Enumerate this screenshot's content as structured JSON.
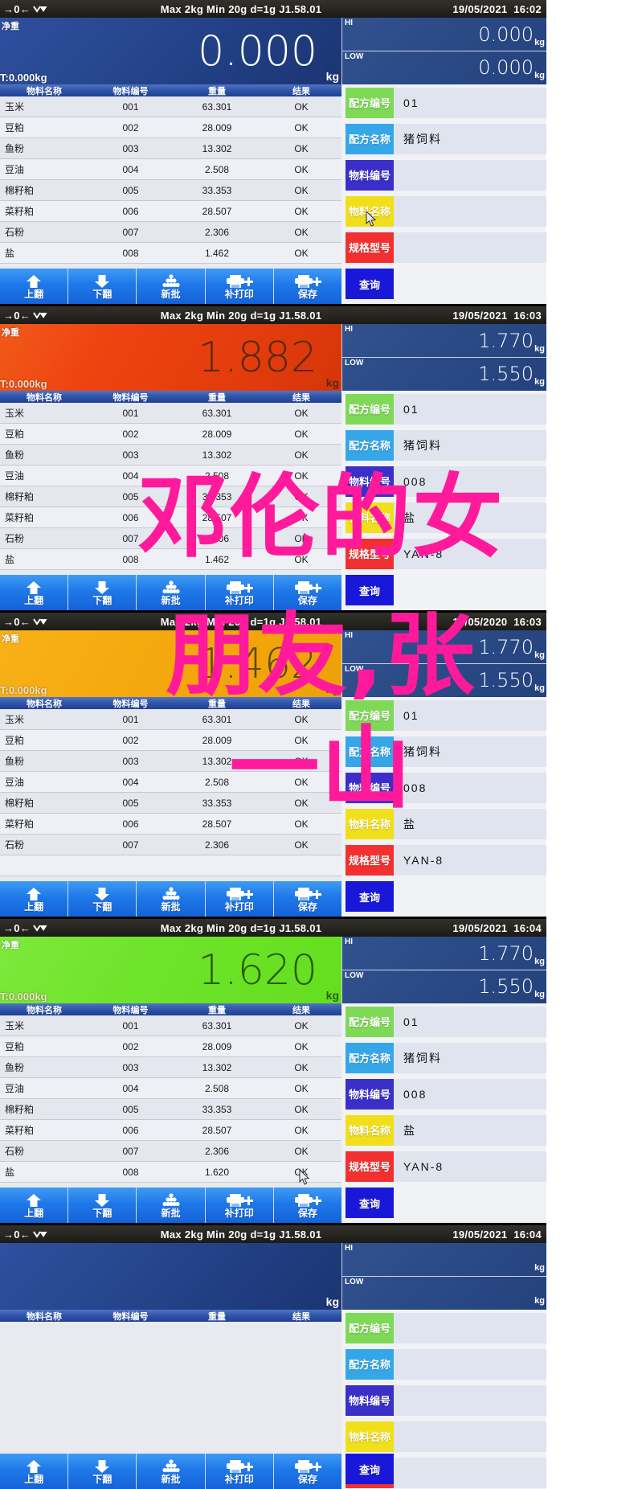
{
  "watermark": {
    "color": "#ff1a9b",
    "line1": "邓伦的女",
    "line2": "朋友,张",
    "line3": "一山"
  },
  "icons": {
    "zero": "→0←",
    "stable": "stable-icon",
    "up_arrow": "up-arrow-icon",
    "down_arrow": "down-arrow-icon",
    "batch": "stacked-bags-icon",
    "printer": "printer-plus-icon",
    "cursor": "mouse-cursor-icon"
  },
  "table_headers": {
    "name": "物料名称",
    "code": "物料编号",
    "weight": "重量",
    "result": "结果"
  },
  "buttons": [
    {
      "label": "上翻",
      "icon": "up-arrow-icon"
    },
    {
      "label": "下翻",
      "icon": "down-arrow-icon"
    },
    {
      "label": "新批",
      "icon": "stacked-bags-icon"
    },
    {
      "label": "补打印",
      "icon": "printer-plus-icon"
    },
    {
      "label": "保存",
      "icon": "printer-plus-icon"
    }
  ],
  "query_button": "查询",
  "field_keys": {
    "recipe_no": "配方编号",
    "recipe_name": "配方名称",
    "material_no": "物料编号",
    "material_name": "物料名称",
    "spec_model": "规格型号"
  },
  "field_colors": {
    "recipe_no": "#7ed957",
    "recipe_name": "#35a7e8",
    "material_no": "#3b2fc9",
    "material_name": "#f2df1b",
    "spec_model": "#f23030"
  },
  "hi_low_labels": {
    "hi": "HI",
    "low": "LOW"
  },
  "unit": "kg",
  "panels": [
    {
      "status": {
        "spec": "Max 2kg  Min 20g  d=1g    J1.58.01",
        "date": "19/05/2021",
        "time": "16:02"
      },
      "weight": {
        "net_label": "净重",
        "value": "0.000",
        "unit": "kg",
        "tare": "T:0.000kg",
        "color": "blue"
      },
      "hi": "0.000",
      "low": "0.000",
      "rows": [
        {
          "name": "玉米",
          "code": "001",
          "weight": "63.301",
          "result": "OK"
        },
        {
          "name": "豆粕",
          "code": "002",
          "weight": "28.009",
          "result": "OK"
        },
        {
          "name": "鱼粉",
          "code": "003",
          "weight": "13.302",
          "result": "OK"
        },
        {
          "name": "豆油",
          "code": "004",
          "weight": "2.508",
          "result": "OK"
        },
        {
          "name": "棉籽粕",
          "code": "005",
          "weight": "33.353",
          "result": "OK"
        },
        {
          "name": "菜籽粕",
          "code": "006",
          "weight": "28.507",
          "result": "OK"
        },
        {
          "name": "石粉",
          "code": "007",
          "weight": "2.306",
          "result": "OK"
        },
        {
          "name": "盐",
          "code": "008",
          "weight": "1.462",
          "result": "OK"
        }
      ],
      "fields": {
        "recipe_no": "01",
        "recipe_name": "猪饲料",
        "material_no": "",
        "material_name": "",
        "spec_model": ""
      }
    },
    {
      "status": {
        "spec": "Max 2kg  Min 20g  d=1g    J1.58.01",
        "date": "19/05/2021",
        "time": "16:03"
      },
      "weight": {
        "net_label": "净重",
        "value": "1.882",
        "unit": "kg",
        "tare": "T:0.000kg",
        "color": "red"
      },
      "hi": "1.770",
      "low": "1.550",
      "rows": [
        {
          "name": "玉米",
          "code": "001",
          "weight": "63.301",
          "result": "OK"
        },
        {
          "name": "豆粕",
          "code": "002",
          "weight": "28.009",
          "result": "OK"
        },
        {
          "name": "鱼粉",
          "code": "003",
          "weight": "13.302",
          "result": "OK"
        },
        {
          "name": "豆油",
          "code": "004",
          "weight": "2.508",
          "result": "OK"
        },
        {
          "name": "棉籽粕",
          "code": "005",
          "weight": "33.353",
          "result": "OK"
        },
        {
          "name": "菜籽粕",
          "code": "006",
          "weight": "28.507",
          "result": "OK"
        },
        {
          "name": "石粉",
          "code": "007",
          "weight": "2.306",
          "result": "OK"
        },
        {
          "name": "盐",
          "code": "008",
          "weight": "1.462",
          "result": "OK"
        }
      ],
      "fields": {
        "recipe_no": "01",
        "recipe_name": "猪饲料",
        "material_no": "008",
        "material_name": "盐",
        "spec_model": "YAN-8"
      }
    },
    {
      "status": {
        "spec": "Max 2kg  Min 20g  d=1g    J1.58.01",
        "date": "19/05/2020",
        "time": "16:03"
      },
      "weight": {
        "net_label": "净重",
        "value": "1.462",
        "unit": "kg",
        "tare": "T:0.000kg",
        "color": "orange"
      },
      "hi": "1.770",
      "low": "1.550",
      "rows": [
        {
          "name": "玉米",
          "code": "001",
          "weight": "63.301",
          "result": "OK"
        },
        {
          "name": "豆粕",
          "code": "002",
          "weight": "28.009",
          "result": "OK"
        },
        {
          "name": "鱼粉",
          "code": "003",
          "weight": "13.302",
          "result": "OK"
        },
        {
          "name": "豆油",
          "code": "004",
          "weight": "2.508",
          "result": "OK"
        },
        {
          "name": "棉籽粕",
          "code": "005",
          "weight": "33.353",
          "result": "OK"
        },
        {
          "name": "菜籽粕",
          "code": "006",
          "weight": "28.507",
          "result": "OK"
        },
        {
          "name": "石粉",
          "code": "007",
          "weight": "2.306",
          "result": "OK"
        },
        {
          "name": "",
          "code": "",
          "weight": "",
          "result": ""
        }
      ],
      "fields": {
        "recipe_no": "01",
        "recipe_name": "猪饲料",
        "material_no": "008",
        "material_name": "盐",
        "spec_model": "YAN-8"
      }
    },
    {
      "status": {
        "spec": "Max 2kg  Min 20g  d=1g    J1.58.01",
        "date": "19/05/2021",
        "time": "16:04"
      },
      "weight": {
        "net_label": "净重",
        "value": "1.620",
        "unit": "kg",
        "tare": "T:0.000kg",
        "color": "green"
      },
      "hi": "1.770",
      "low": "1.550",
      "rows": [
        {
          "name": "玉米",
          "code": "001",
          "weight": "63.301",
          "result": "OK"
        },
        {
          "name": "豆粕",
          "code": "002",
          "weight": "28.009",
          "result": "OK"
        },
        {
          "name": "鱼粉",
          "code": "003",
          "weight": "13.302",
          "result": "OK"
        },
        {
          "name": "豆油",
          "code": "004",
          "weight": "2.508",
          "result": "OK"
        },
        {
          "name": "棉籽粕",
          "code": "005",
          "weight": "33.353",
          "result": "OK"
        },
        {
          "name": "菜籽粕",
          "code": "006",
          "weight": "28.507",
          "result": "OK"
        },
        {
          "name": "石粉",
          "code": "007",
          "weight": "2.306",
          "result": "OK"
        },
        {
          "name": "盐",
          "code": "008",
          "weight": "1.620",
          "result": "OK"
        }
      ],
      "fields": {
        "recipe_no": "01",
        "recipe_name": "猪饲料",
        "material_no": "008",
        "material_name": "盐",
        "spec_model": "YAN-8"
      }
    },
    {
      "status": {
        "spec": "Max 2kg  Min 20g  d=1g    J1.58.01",
        "date": "19/05/2021",
        "time": "16:04"
      },
      "weight": {
        "net_label": "",
        "value": "",
        "unit": "kg",
        "tare": "",
        "color": "blue"
      },
      "hi": "",
      "low": "",
      "rows": [],
      "fields": {
        "recipe_no": "",
        "recipe_name": "",
        "material_no": "",
        "material_name": "",
        "spec_model": ""
      }
    }
  ]
}
